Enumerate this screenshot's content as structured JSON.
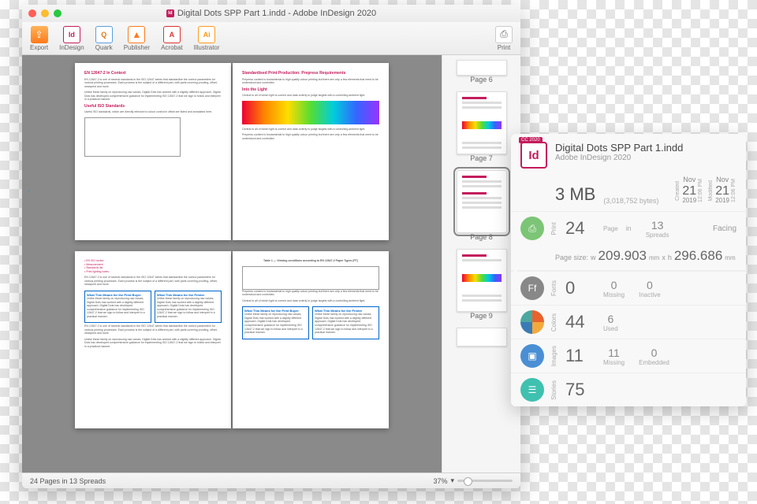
{
  "window": {
    "title": "Digital Dots SPP Part 1.indd - Adobe InDesign 2020"
  },
  "toolbar": {
    "export": "Export",
    "indesign": "InDesign",
    "quark": "Quark",
    "publisher": "Publisher",
    "acrobat": "Acrobat",
    "illustrator": "Illustrator",
    "print": "Print"
  },
  "doc": {
    "spread1": {
      "left": {
        "h1": "EN 12647-2 In Context",
        "p1": "EN 12647-2 is one of several standards in the ISO 12647 series that standardise the control parameters for various printing processes. Each process is the subject of a different part, with parts covering proofing, offset, newsprint and more.",
        "p2": "Unlike these family on reproducing raw values, Digital Dots has worked with a slightly different approach. Digital Dots has developed comprehensive guidance for implementing ISO 12647-2 that we sign to follow and interpret in a practical manner.",
        "h2": "Useful ISO Standards",
        "p3": "Useful ISO standards, which are directly relevant to colour control in offset are listed and annotated here."
      },
      "right": {
        "h1": "Standardised Print Production: Prepress Requirements",
        "p1": "Prepress content is fundamental to high quality colour printing but there are only a few elements that need to be understood and controlled.",
        "h2": "Into the Light",
        "p2": "Central to all of which light is correct and data orderly to judge targets with a controlling ambient light."
      }
    },
    "spread2": {
      "left": {
        "blue1_h": "What This Means for the Print Buyer",
        "blue2_h": "What This Means for the Printer"
      },
      "right": {
        "tablecap": "Table 1 — Viewing conditions according to EN 12647-2 Paper Types (PT)",
        "blue1_h": "What This Means for the Print Buyer",
        "blue2_h": "What This Means for the Printer"
      }
    }
  },
  "thumbs": {
    "p6": "Page 6",
    "p7": "Page 7",
    "p8": "Page 8",
    "p9": "Page 9"
  },
  "status": {
    "pages": "24 Pages in 13 Spreads",
    "zoom": "37%"
  },
  "info": {
    "badge": "CC 2020",
    "logo": "Id",
    "filename": "Digital Dots SPP Part 1.indd",
    "app": "Adobe InDesign 2020",
    "size": "3 MB",
    "bytes": "(3,018,752 bytes)",
    "created_label": "Created",
    "modified_label": "Modified",
    "date_mon": "Nov",
    "date_day": "21",
    "date_year": "2019",
    "date_time": "12:06 PM",
    "print_label": "Print",
    "pages_n": "24",
    "pages_l": "Page",
    "in": "in",
    "spreads_n": "13",
    "spreads_l": "Spreads",
    "facing": "Facing",
    "pgsize_label": "Page size:",
    "pgw_pre": "w",
    "pgw": "209.903",
    "pgunit": "mm",
    "pgx": "x",
    "pgh_pre": "h",
    "pgh": "296.686",
    "fonts_label": "Fonts",
    "fonts_n": "0",
    "fonts_missing_n": "0",
    "fonts_missing_l": "Missing",
    "fonts_inactive_n": "0",
    "fonts_inactive_l": "Inactive",
    "colors_label": "Colors",
    "colors_n": "44",
    "colors_used_n": "6",
    "colors_used_l": "Used",
    "images_label": "Images",
    "images_n": "11",
    "images_missing_n": "11",
    "images_missing_l": "Missing",
    "images_emb_n": "0",
    "images_emb_l": "Embedded",
    "stories_label": "Stories",
    "stories_n": "75"
  }
}
